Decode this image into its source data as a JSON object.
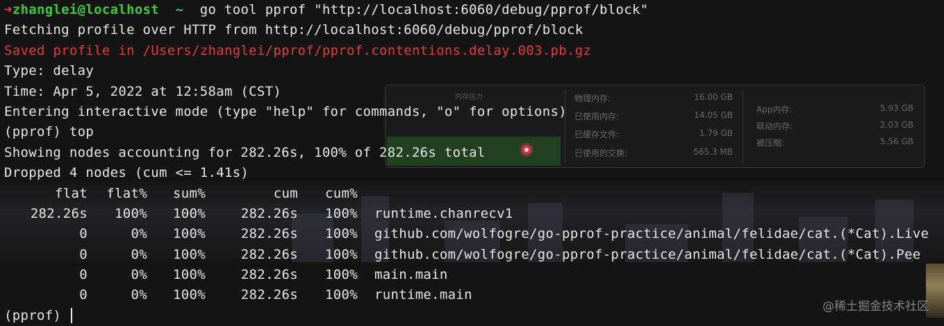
{
  "prompt": {
    "arrow": "➜",
    "user_host": "zhanglei@localhost",
    "cwd": "~",
    "command": "go tool pprof \"http://localhost:6060/debug/pprof/block\""
  },
  "output": {
    "fetching": "Fetching profile over HTTP from http://localhost:6060/debug/pprof/block",
    "saved": "Saved profile in /Users/zhanglei/pprof/pprof.contentions.delay.003.pb.gz",
    "type": "Type: delay",
    "time": "Time: Apr 5, 2022 at 12:58am (CST)",
    "interactive": "Entering interactive mode (type \"help\" for commands, \"o\" for options)",
    "top_cmd": "(pprof) top",
    "showing": "Showing nodes accounting for 282.26s, 100% of 282.26s total",
    "dropped": "Dropped 4 nodes (cum <= 1.41s)",
    "final_prompt": "(pprof) "
  },
  "table": {
    "headers": [
      "flat",
      "flat%",
      "sum%",
      "cum",
      "cum%"
    ],
    "rows": [
      {
        "flat": "282.26s",
        "flat_pct": "100%",
        "sum_pct": "100%",
        "cum": "282.26s",
        "cum_pct": "100%",
        "name": "runtime.chanrecv1"
      },
      {
        "flat": "0",
        "flat_pct": "0%",
        "sum_pct": "100%",
        "cum": "282.26s",
        "cum_pct": "100%",
        "name": "github.com/wolfogre/go-pprof-practice/animal/felidae/cat.(*Cat).Live"
      },
      {
        "flat": "0",
        "flat_pct": "0%",
        "sum_pct": "100%",
        "cum": "282.26s",
        "cum_pct": "100%",
        "name": "github.com/wolfogre/go-pprof-practice/animal/felidae/cat.(*Cat).Pee"
      },
      {
        "flat": "0",
        "flat_pct": "0%",
        "sum_pct": "100%",
        "cum": "282.26s",
        "cum_pct": "100%",
        "name": "main.main"
      },
      {
        "flat": "0",
        "flat_pct": "0%",
        "sum_pct": "100%",
        "cum": "282.26s",
        "cum_pct": "100%",
        "name": "runtime.main"
      }
    ]
  },
  "memory_overlay": {
    "pressure_title": "内存压力",
    "left": [
      {
        "label": "物理内存:",
        "value": "16.00 GB"
      },
      {
        "label": "已使用内存:",
        "value": "14.05 GB"
      },
      {
        "label": "已缓存文件:",
        "value": "1.79 GB"
      },
      {
        "label": "已使用的交换:",
        "value": "565.3 MB"
      }
    ],
    "right": [
      {
        "label": "App内存:",
        "value": "5.93 GB"
      },
      {
        "label": "联动内存:",
        "value": "2.03 GB"
      },
      {
        "label": "被压缩:",
        "value": "5.56 GB"
      }
    ]
  },
  "watermark": "@稀土掘金技术社区",
  "colors": {
    "background": "#141414",
    "text": "#e8e8e8",
    "prompt_user": "#3ec83e",
    "prompt_arrow": "#e04545",
    "prompt_tilde": "#4aa8d8",
    "error_text": "#e03a3a"
  }
}
